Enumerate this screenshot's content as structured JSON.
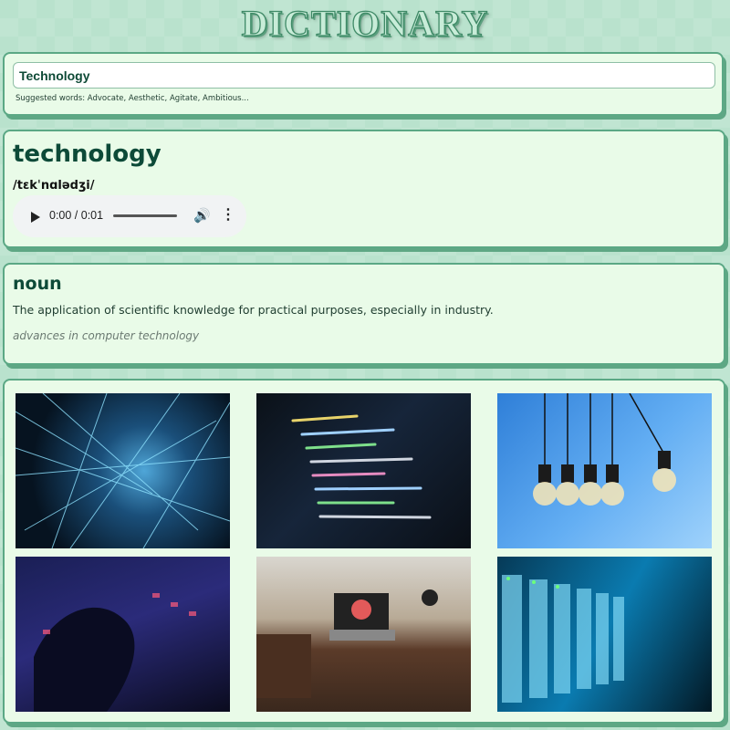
{
  "app": {
    "title": "DICTIONARY"
  },
  "search": {
    "value": "Technology",
    "suggestions": "Suggested words: Advocate, Aesthetic, Agitate, Ambitious..."
  },
  "entry": {
    "word": "technology",
    "phonetic": "/tɛkˈnɑlədʒi/",
    "audio": {
      "time": "0:00 / 0:01",
      "progress": 0
    }
  },
  "meaning": {
    "part_of_speech": "noun",
    "definition": "The application of scientific knowledge for practical purposes, especially in industry.",
    "example": "advances in computer technology"
  },
  "images": [
    {
      "name": "network-lines-image"
    },
    {
      "name": "code-screen-image"
    },
    {
      "name": "light-bulbs-image"
    },
    {
      "name": "keyboard-hand-image"
    },
    {
      "name": "desk-laptop-image"
    },
    {
      "name": "server-rack-image"
    }
  ],
  "colors": {
    "background": "#b9e2cd",
    "card": "#e9fbe8",
    "card_border": "#5ba885",
    "heading": "#0d4a38"
  }
}
